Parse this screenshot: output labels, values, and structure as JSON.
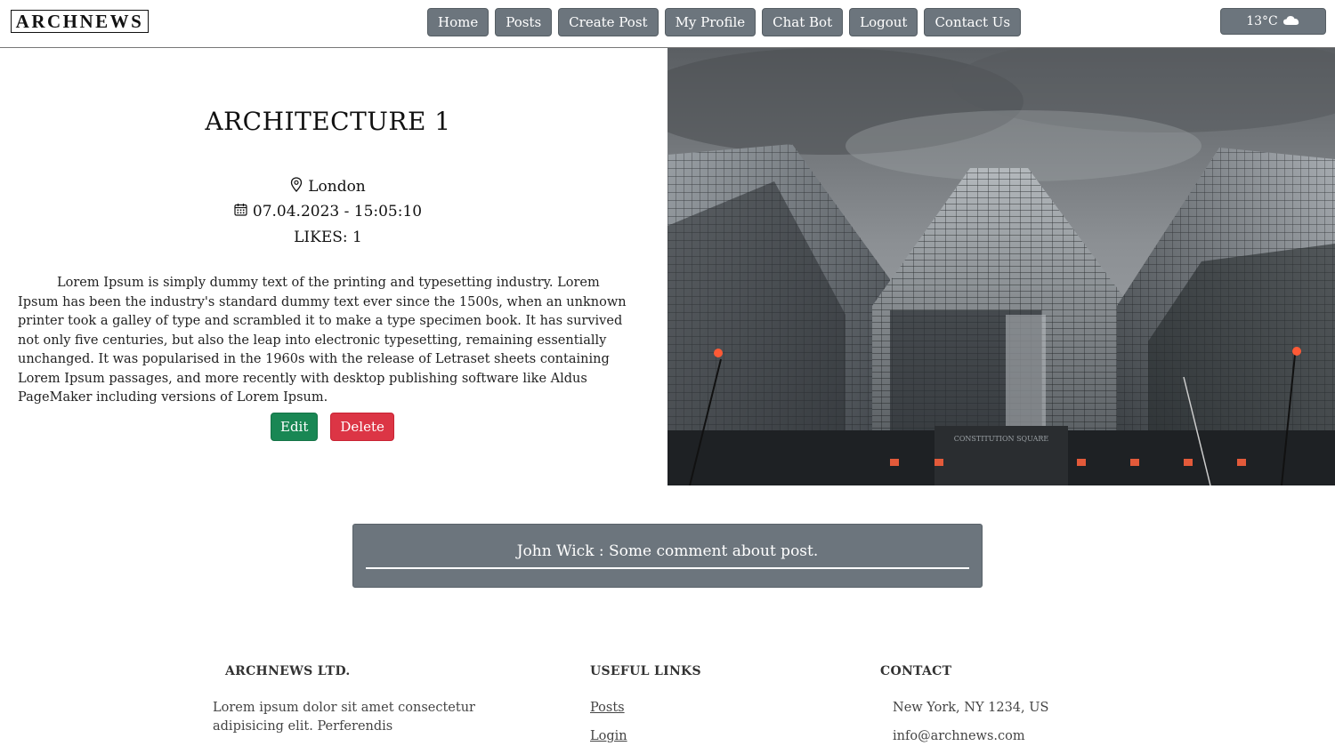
{
  "navbar": {
    "logo": "ARCHNEWS",
    "links": [
      "Home",
      "Posts",
      "Create Post",
      "My Profile",
      "Chat Bot",
      "Logout",
      "Contact Us"
    ],
    "weather": {
      "temperature": "13°C",
      "icon": "cloud-icon"
    }
  },
  "post": {
    "title": "ARCHITECTURE 1",
    "location": "London",
    "datetime": "07.04.2023 - 15:05:10",
    "likes": "LIKES: 1",
    "body": "Lorem Ipsum is simply dummy text of the printing and typesetting industry. Lorem Ipsum has been the industry's standard dummy text ever since the 1500s, when an unknown printer took a galley of type and scrambled it to make a type specimen book. It has survived not only five centuries, but also the leap into electronic typesetting, remaining essentially unchanged. It was popularised in the 1960s with the release of Letraset sheets containing Lorem Ipsum passages, and more recently with desktop publishing software like Aldus PageMaker including versions of Lorem Ipsum.",
    "edit_label": "Edit",
    "delete_label": "Delete",
    "building_sign": "CONSTITUTION SQUARE"
  },
  "comment": {
    "text": "John Wick : Some comment about post."
  },
  "footer": {
    "company": {
      "heading": "ARCHNEWS LTD.",
      "text": "Lorem ipsum dolor sit amet consectetur adipisicing elit. Perferendis"
    },
    "links": {
      "heading": "USEFUL LINKS",
      "items": [
        "Posts",
        "Login"
      ]
    },
    "contact": {
      "heading": "CONTACT",
      "address": "New York, NY 1234, US",
      "email": "info@archnews.com"
    }
  },
  "colors": {
    "nav_button": "#6c757d",
    "edit": "#198754",
    "delete": "#dc3545"
  }
}
